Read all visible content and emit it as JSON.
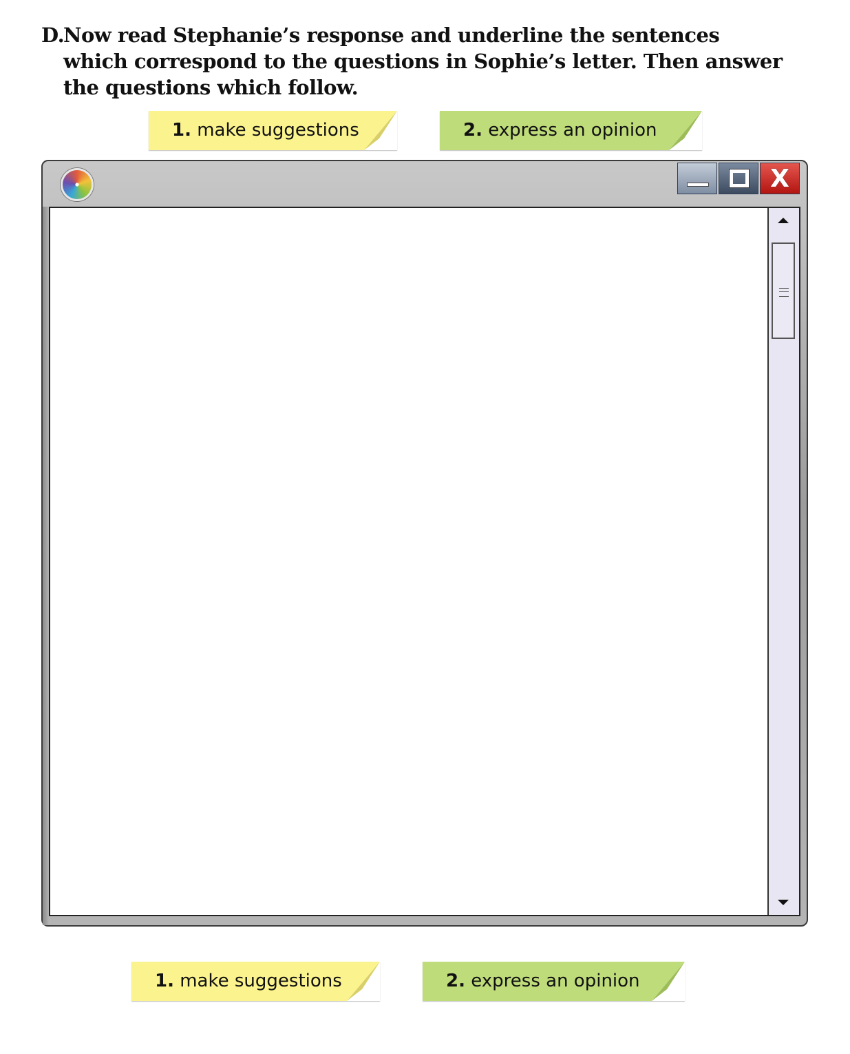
{
  "instruction": {
    "letter": "D.",
    "text": "Now read Stephanie’s response and underline the sentences which correspond to the questions in Sophie’s letter. Then answer the questions which follow."
  },
  "notes_top": [
    {
      "number": "1.",
      "label": "make suggestions",
      "color": "#fbf38d"
    },
    {
      "number": "2.",
      "label": "express an opinion",
      "color": "#bfdc7a"
    }
  ],
  "notes_bottom": [
    {
      "number": "1.",
      "label": "make suggestions",
      "color": "#fbf38d"
    },
    {
      "number": "2.",
      "label": "express an opinion",
      "color": "#bfdc7a"
    }
  ],
  "window": {
    "app_icon": "multicolor-swirl-icon",
    "controls": {
      "minimize": "minimize-icon",
      "maximize": "maximize-icon",
      "close_symbol": "X"
    },
    "content_text": "",
    "scrollbar": {
      "up": "arrow-up-icon",
      "down": "arrow-down-icon",
      "thumb_position": 0.0
    }
  }
}
